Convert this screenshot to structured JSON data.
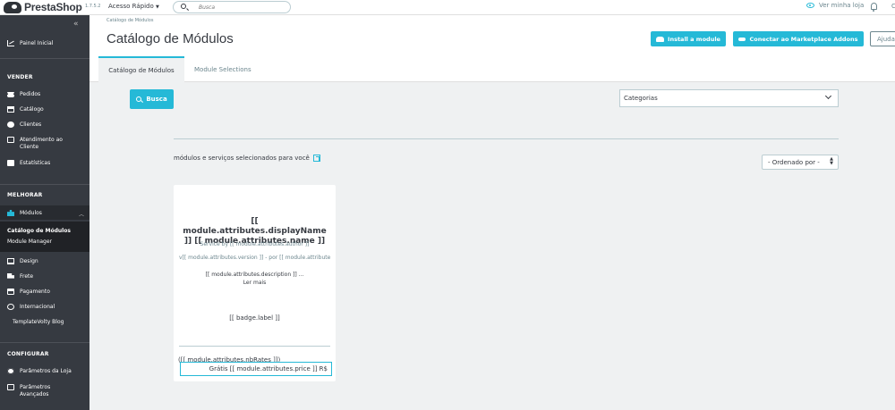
{
  "topbar": {
    "brand": "PrestaShop",
    "version": "1.7.5.2",
    "quick_access": "Acesso Rápido",
    "search_placeholder": "Busca",
    "view_store": "Ver minha loja",
    "profile_initial": "C"
  },
  "sidebar": {
    "dashboard": "Painel Inicial",
    "sections": {
      "sell": "VENDER",
      "improve": "MELHORAR",
      "configure": "CONFIGURAR"
    },
    "sell_items": [
      {
        "label": "Pedidos",
        "icon": "cart-icon"
      },
      {
        "label": "Catálogo",
        "icon": "catalog-icon"
      },
      {
        "label": "Clientes",
        "icon": "customers-icon"
      },
      {
        "label": "Atendimento ao Cliente",
        "icon": "chat-icon"
      },
      {
        "label": "Estatísticas",
        "icon": "stats-icon"
      }
    ],
    "improve_items": [
      {
        "label": "Módulos",
        "icon": "puzzle-icon"
      },
      {
        "label": "Design",
        "icon": "screen-icon"
      },
      {
        "label": "Frete",
        "icon": "truck-icon"
      },
      {
        "label": "Pagamento",
        "icon": "card-icon"
      },
      {
        "label": "Internacional",
        "icon": "globe-icon"
      },
      {
        "label": "TemplateVolty Blog",
        "icon": ""
      }
    ],
    "modules_sub": [
      {
        "label": "Catálogo de Módulos",
        "active": true
      },
      {
        "label": "Module Manager",
        "active": false
      }
    ],
    "configure_items": [
      {
        "label": "Parâmetros da Loja",
        "icon": "gear-icon"
      },
      {
        "label": "Parâmetros Avançados",
        "icon": "settings-icon"
      }
    ]
  },
  "header": {
    "breadcrumb": "Catálogo de Módulos",
    "title": "Catálogo de Módulos",
    "install_button": "Install a module",
    "connect_button": "Conectar ao Marketplace Addons",
    "help_button": "Ajuda",
    "tabs": [
      {
        "label": "Catálogo de Módulos",
        "active": true
      },
      {
        "label": "Module Selections",
        "active": false
      }
    ]
  },
  "main": {
    "search_button": "Busca",
    "categories_select": "Categorias",
    "selected_for_you": "módulos e serviços selecionados para você",
    "sort_select": "- Ordenado por -",
    "card": {
      "title": "[[ module.attributes.displayName ]] [[ module.attributes.name ]]",
      "author": "Service by [[ module.attributes.author ]]",
      "version": "v[[ module.attributes.version ]] - por [[ module.attribute...",
      "description": "[[ module.attributes.description ]] ...",
      "read_more": "Ler mais",
      "badge": "[[ badge.label ]]",
      "rates": "([[ module.attributes.nbRates ]])",
      "price": "Grátis [[ module.attributes.price ]] R$"
    }
  },
  "colors": {
    "accent": "#25b9d7",
    "sidebar_bg": "#363a41",
    "text": "#363a41",
    "muted": "#6c868e",
    "page_bg": "#eff1f2"
  }
}
